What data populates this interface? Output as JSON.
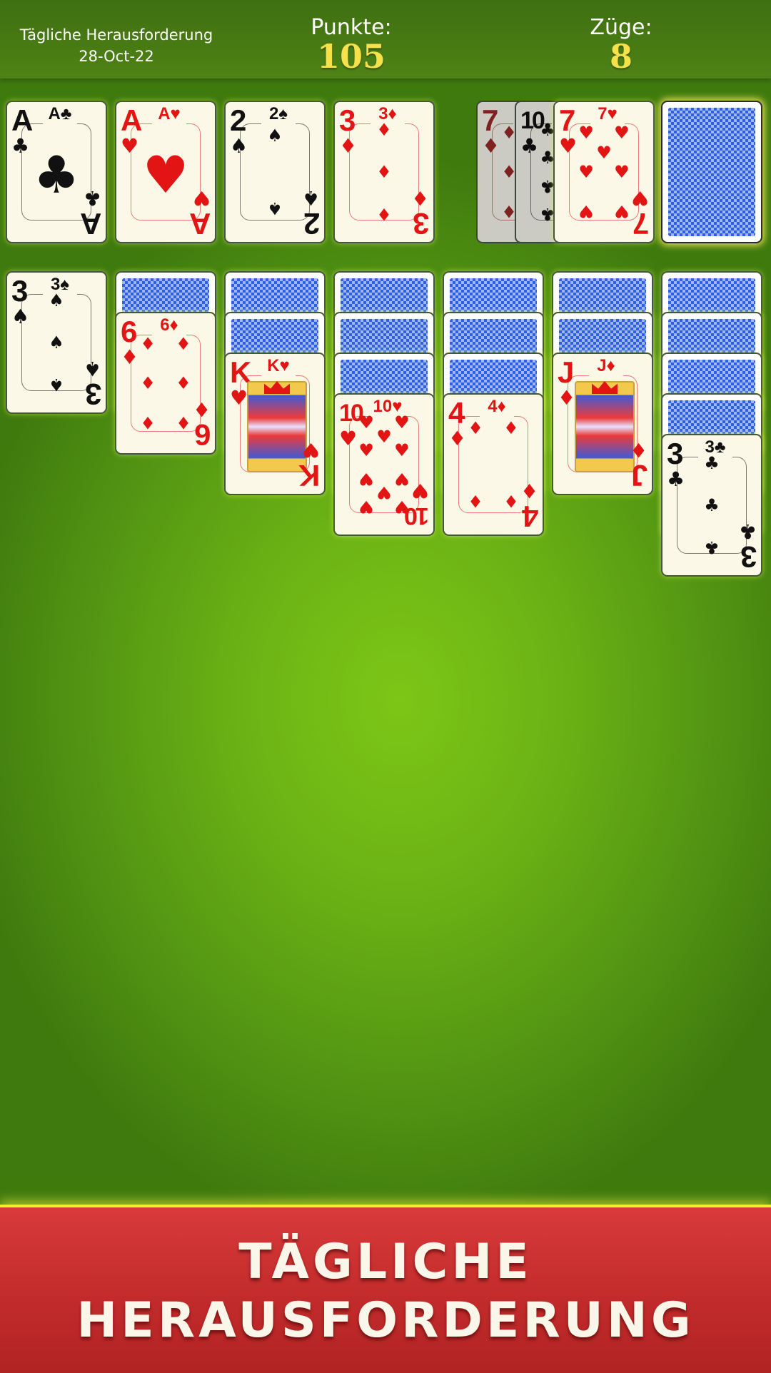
{
  "header": {
    "challenge_title": "Tägliche Herausforderung",
    "challenge_date": "28-Oct-22",
    "points_label": "Punkte:",
    "points_value": "105",
    "moves_label": "Züge:",
    "moves_value": "8"
  },
  "foundations": [
    {
      "rank": "A",
      "suit": "♣",
      "color": "black"
    },
    {
      "rank": "A",
      "suit": "♥",
      "color": "red"
    },
    {
      "rank": "2",
      "suit": "♠",
      "color": "black"
    },
    {
      "rank": "3",
      "suit": "♦",
      "color": "red"
    }
  ],
  "waste": [
    {
      "rank": "7",
      "suit": "♦",
      "color": "red"
    },
    {
      "rank": "10",
      "suit": "♣",
      "color": "black"
    },
    {
      "rank": "7",
      "suit": "♥",
      "color": "red"
    }
  ],
  "stock": {
    "face_down": true
  },
  "tableau": [
    {
      "face_down_count": 0,
      "top": {
        "rank": "3",
        "suit": "♠",
        "color": "black"
      }
    },
    {
      "face_down_count": 1,
      "top": {
        "rank": "6",
        "suit": "♦",
        "color": "red"
      }
    },
    {
      "face_down_count": 2,
      "top": {
        "rank": "K",
        "suit": "♥",
        "color": "red"
      }
    },
    {
      "face_down_count": 3,
      "top": {
        "rank": "10",
        "suit": "♥",
        "color": "red"
      }
    },
    {
      "face_down_count": 3,
      "top": {
        "rank": "4",
        "suit": "♦",
        "color": "red"
      }
    },
    {
      "face_down_count": 2,
      "top": {
        "rank": "J",
        "suit": "♦",
        "color": "red"
      }
    },
    {
      "face_down_count": 4,
      "top": {
        "rank": "3",
        "suit": "♣",
        "color": "black"
      }
    }
  ],
  "banner": {
    "line1": "TÄGLICHE",
    "line2": "HERAUSFORDERUNG"
  },
  "colors": {
    "felt": "#6cb315",
    "header": "#4a7c14",
    "score": "#f6e14a",
    "banner": "#c32b2b",
    "card_back": "#2d5fe6",
    "red_suit": "#e21414"
  }
}
